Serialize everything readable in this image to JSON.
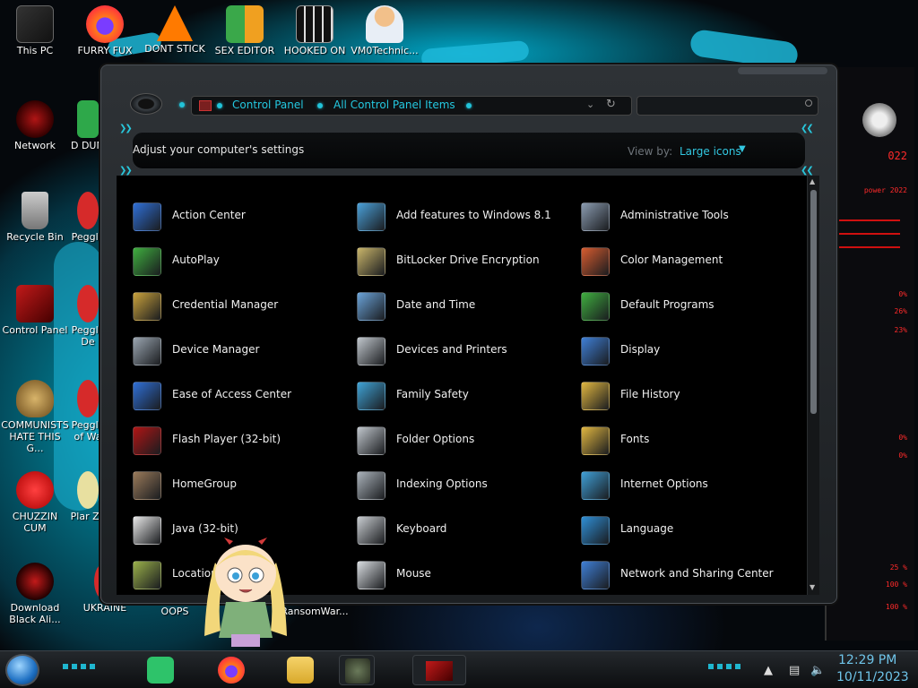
{
  "desktop": {
    "icons_col1": [
      {
        "label": "This PC"
      },
      {
        "label": "Network"
      },
      {
        "label": "Recycle Bin"
      },
      {
        "label": "Control Panel"
      },
      {
        "label": "COMMUNISTS HATE THIS G..."
      },
      {
        "label": "CHUZZIN CUM"
      },
      {
        "label": "Download Black Ali..."
      }
    ],
    "icons_top": [
      {
        "label": "FURRY FUX"
      },
      {
        "label": "DONT STICK"
      },
      {
        "label": "SEX EDITOR"
      },
      {
        "label": "HOOKED ON"
      },
      {
        "label": "VM0Technic..."
      }
    ],
    "icons_col2": [
      {
        "label": "D DUM"
      },
      {
        "label": "Peggle"
      },
      {
        "label": "Peggle De"
      },
      {
        "label": "Peggle of Wa"
      },
      {
        "label": "Plar Zo"
      },
      {
        "label": "UKRAINE"
      }
    ],
    "icons_bottom": [
      {
        "label": "OOPS"
      },
      {
        "label": "RansomWar..."
      }
    ]
  },
  "gadget": {
    "lines": [
      "022",
      "power 2022",
      "0%",
      "26%",
      "23%",
      "0%",
      "0%",
      "25 %",
      "100 %",
      "100 %"
    ]
  },
  "window": {
    "breadcrumbs": [
      "Control Panel",
      "All Control Panel Items"
    ],
    "header_title": "Adjust your computer's settings",
    "view_by_label": "View by:",
    "view_by_value": "Large icons",
    "items": [
      {
        "label": "Action Center",
        "icon": "flag-icon",
        "color": "#2f6fd6"
      },
      {
        "label": "Add features to Windows 8.1",
        "icon": "add-features-icon",
        "color": "#4aa0d8"
      },
      {
        "label": "Administrative Tools",
        "icon": "gears-icon",
        "color": "#8a9bb0"
      },
      {
        "label": "AutoPlay",
        "icon": "autoplay-icon",
        "color": "#3fae3f"
      },
      {
        "label": "BitLocker Drive Encryption",
        "icon": "keys-icon",
        "color": "#c9b56a"
      },
      {
        "label": "Color Management",
        "icon": "color-management-icon",
        "color": "#d65b2f"
      },
      {
        "label": "Credential Manager",
        "icon": "credential-vault-icon",
        "color": "#c9a23c"
      },
      {
        "label": "Date and Time",
        "icon": "calendar-clock-icon",
        "color": "#6aa3d8"
      },
      {
        "label": "Default Programs",
        "icon": "default-programs-icon",
        "color": "#3fae3f"
      },
      {
        "label": "Device Manager",
        "icon": "device-manager-icon",
        "color": "#9aa5b0"
      },
      {
        "label": "Devices and Printers",
        "icon": "printer-icon",
        "color": "#c0c6cc"
      },
      {
        "label": "Display",
        "icon": "monitor-icon",
        "color": "#3f7fd6"
      },
      {
        "label": "Ease of Access Center",
        "icon": "ease-of-access-icon",
        "color": "#2f6fd6"
      },
      {
        "label": "Family Safety",
        "icon": "family-icon",
        "color": "#3fa3d6"
      },
      {
        "label": "File History",
        "icon": "folder-clock-icon",
        "color": "#e0b640"
      },
      {
        "label": "Flash Player (32-bit)",
        "icon": "flash-icon",
        "color": "#b01515"
      },
      {
        "label": "Folder Options",
        "icon": "folder-options-icon",
        "color": "#c0c6cc"
      },
      {
        "label": "Fonts",
        "icon": "fonts-folder-icon",
        "color": "#e0b640"
      },
      {
        "label": "HomeGroup",
        "icon": "house-icon",
        "color": "#9a7a5a"
      },
      {
        "label": "Indexing Options",
        "icon": "magnifier-icon",
        "color": "#aab2ba"
      },
      {
        "label": "Internet Options",
        "icon": "globe-icon",
        "color": "#3f9fd6"
      },
      {
        "label": "Java (32-bit)",
        "icon": "java-icon",
        "color": "#e8e8e8"
      },
      {
        "label": "Keyboard",
        "icon": "keyboard-icon",
        "color": "#c8ccd0"
      },
      {
        "label": "Language",
        "icon": "language-globe-icon",
        "color": "#2f8fd6"
      },
      {
        "label": "Location",
        "icon": "location-icon",
        "color": "#9ab04a"
      },
      {
        "label": "Mouse",
        "icon": "mouse-icon",
        "color": "#d8dce0"
      },
      {
        "label": "Network and Sharing Center",
        "icon": "network-icon",
        "color": "#3f7fd6"
      }
    ]
  },
  "taskbar": {
    "time": "12:29 PM",
    "date": "10/11/2023"
  },
  "colors": {
    "accent_cyan": "#24c8e0",
    "gadget_red": "#ff2a2a"
  }
}
